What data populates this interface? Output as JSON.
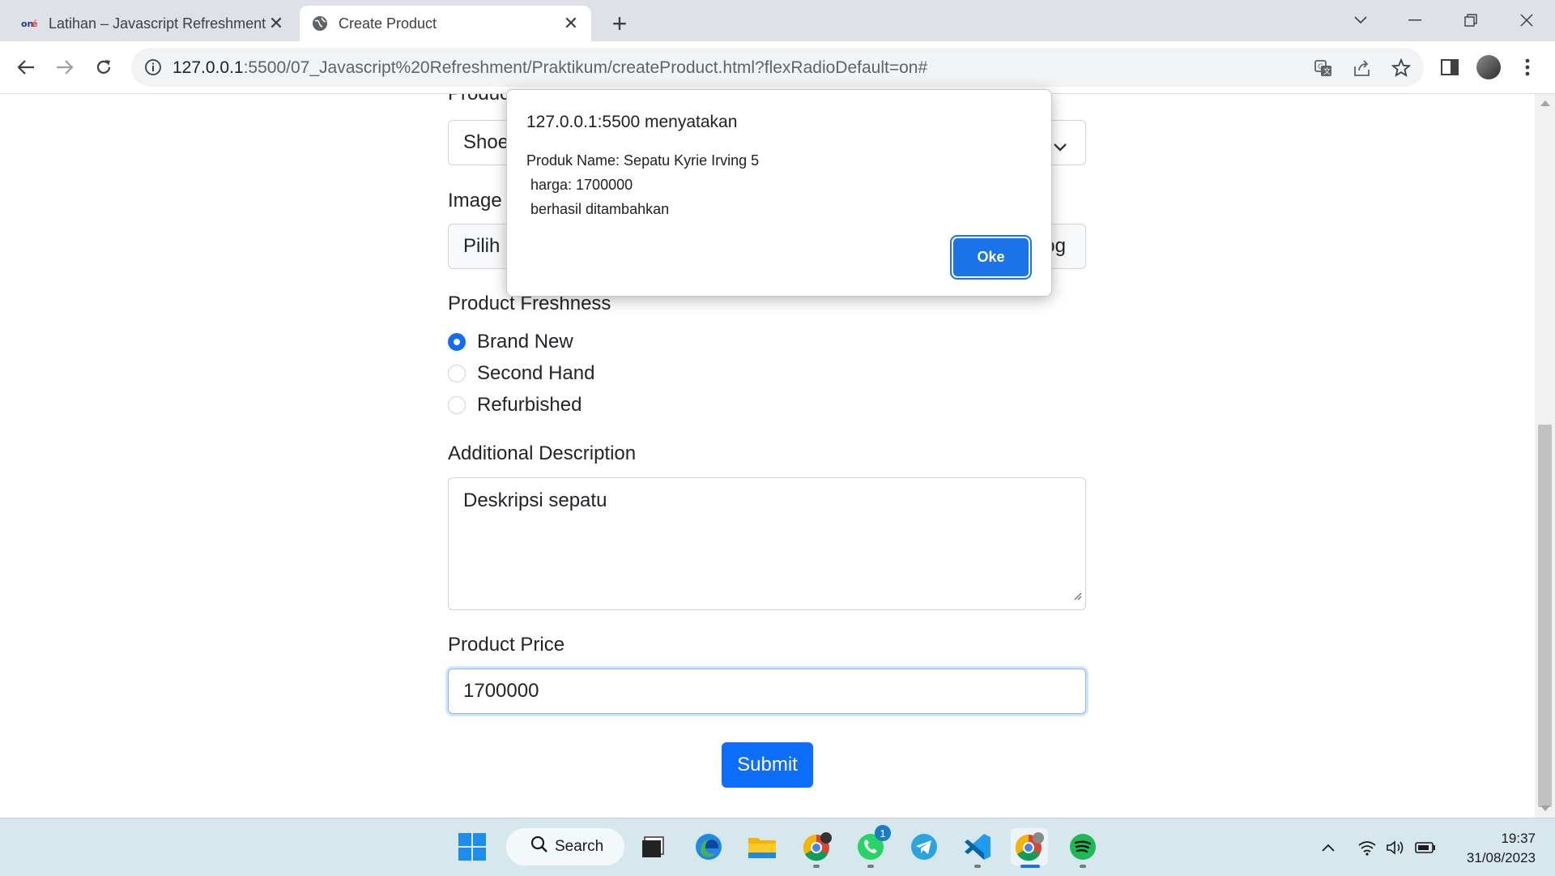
{
  "browser": {
    "tabs": [
      {
        "title": "Latihan – Javascript Refreshment",
        "favicon": "one-logo-icon",
        "active": false
      },
      {
        "title": "Create Product",
        "favicon": "globe-icon",
        "active": true
      }
    ],
    "url_host": "127.0.0.1",
    "url_rest": ":5500/07_Javascript%20Refreshment/Praktikum/createProduct.html?flexRadioDefault=on#"
  },
  "form": {
    "category_label": "Produc",
    "category_value": "Shoe",
    "image_label": "Image",
    "image_button": "Pilih",
    "image_filename_tail": "og",
    "freshness_label": "Product Freshness",
    "freshness_options": [
      {
        "label": "Brand New",
        "checked": true
      },
      {
        "label": "Second Hand",
        "checked": false
      },
      {
        "label": "Refurbished",
        "checked": false
      }
    ],
    "description_label": "Additional Description",
    "description_value": "Deskripsi sepatu",
    "price_label": "Product Price",
    "price_value": "1700000",
    "submit_label": "Submit"
  },
  "dialog": {
    "title": "127.0.0.1:5500 menyatakan",
    "message_lines": [
      "Produk Name: Sepatu Kyrie Irving 5",
      " harga: 1700000",
      " berhasil ditambahkan"
    ],
    "ok_label": "Oke"
  },
  "taskbar": {
    "search_label": "Search",
    "whatsapp_badge": "1",
    "time": "19:37",
    "date": "31/08/2023"
  },
  "colors": {
    "primary": "#0d6efd",
    "dialog_button": "#1a73e8",
    "taskbar_bg": "#d6e7ee"
  }
}
